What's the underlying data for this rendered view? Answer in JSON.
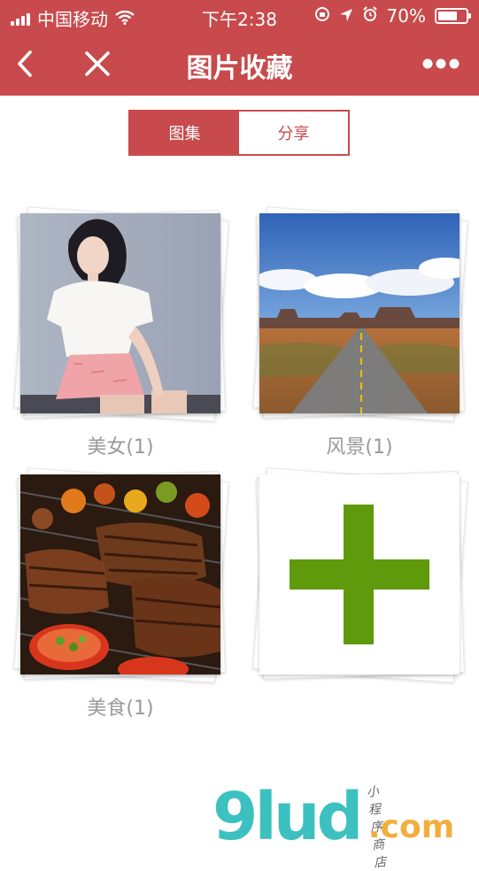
{
  "status_bar": {
    "carrier": "中国移动",
    "time": "下午2:38",
    "battery_percent": "70%",
    "battery_level": 0.7
  },
  "nav": {
    "title": "图片收藏",
    "back_icon": "chevron-left-icon",
    "close_icon": "close-icon",
    "more_icon": "more-dots-icon"
  },
  "tabs": [
    {
      "label": "图集",
      "active": true
    },
    {
      "label": "分享",
      "active": false
    }
  ],
  "albums": [
    {
      "caption": "美女(1)",
      "thumb": "portrait-photo"
    },
    {
      "caption": "风景(1)",
      "thumb": "landscape-photo"
    },
    {
      "caption": "美食(1)",
      "thumb": "food-photo"
    }
  ],
  "add_card": {
    "icon": "plus-icon"
  },
  "watermark": {
    "logo": "9lud",
    "suffix": ".com",
    "tagline": "小程序商店"
  },
  "colors": {
    "primary": "#c84a4c",
    "plus": "#5e9a0b",
    "caption": "#999999",
    "logo": "#3cc0c0",
    "logo_suffix": "#f2ae3c"
  }
}
